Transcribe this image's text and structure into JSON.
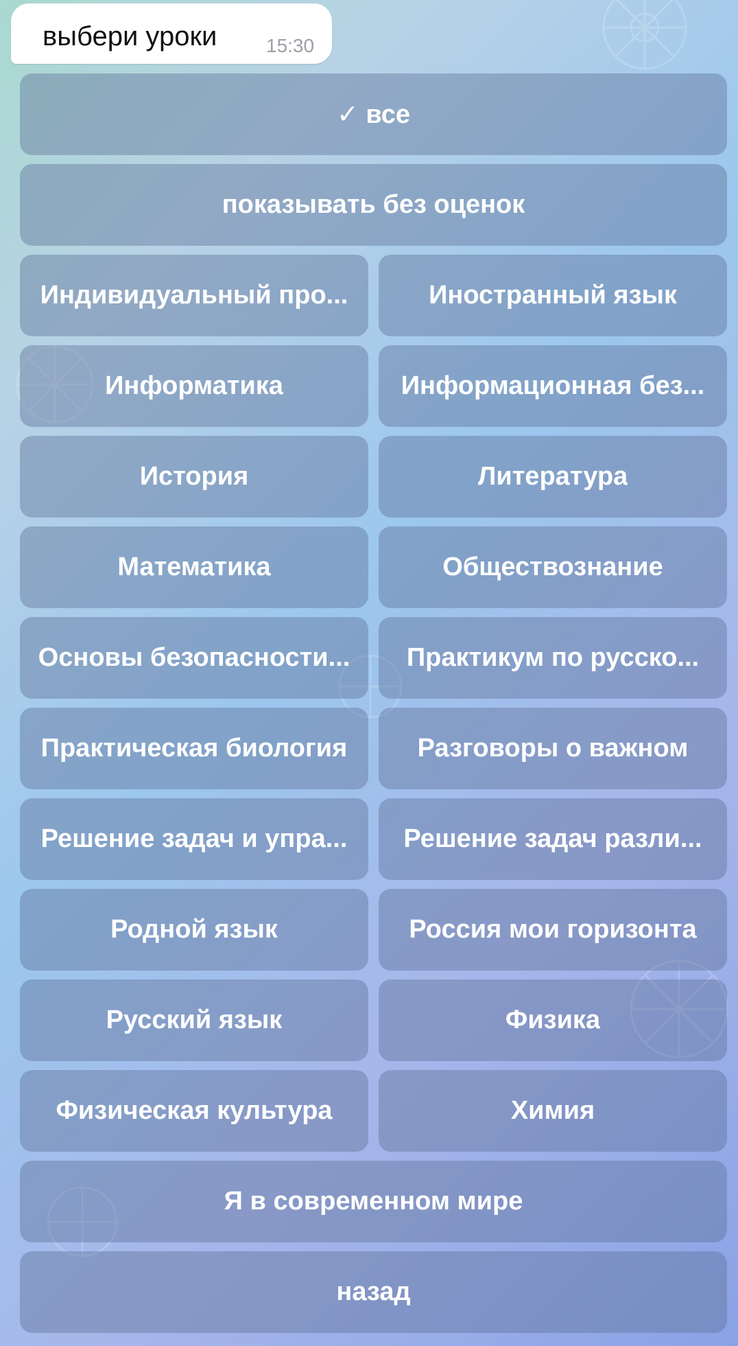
{
  "chat": {
    "message_text": "выбери уроки",
    "message_time": "15:30"
  },
  "keyboard": {
    "all_button": "✓ все",
    "show_without_grades_button": "показывать без оценок",
    "subjects": [
      "Индивидуальный про...",
      "Иностранный язык",
      "Информатика",
      "Информационная без...",
      "История",
      "Литература",
      "Математика",
      "Обществознание",
      "Основы безопасности...",
      "Практикум по русско...",
      "Практическая биология",
      "Разговоры о важном",
      "Решение задач и упра...",
      "Решение задач разли...",
      "Родной язык",
      "Россия мои горизонта",
      "Русский язык",
      "Физика",
      "Физическая культура",
      "Химия"
    ],
    "modern_world_button": "Я в современном мире",
    "back_button": "назад"
  }
}
